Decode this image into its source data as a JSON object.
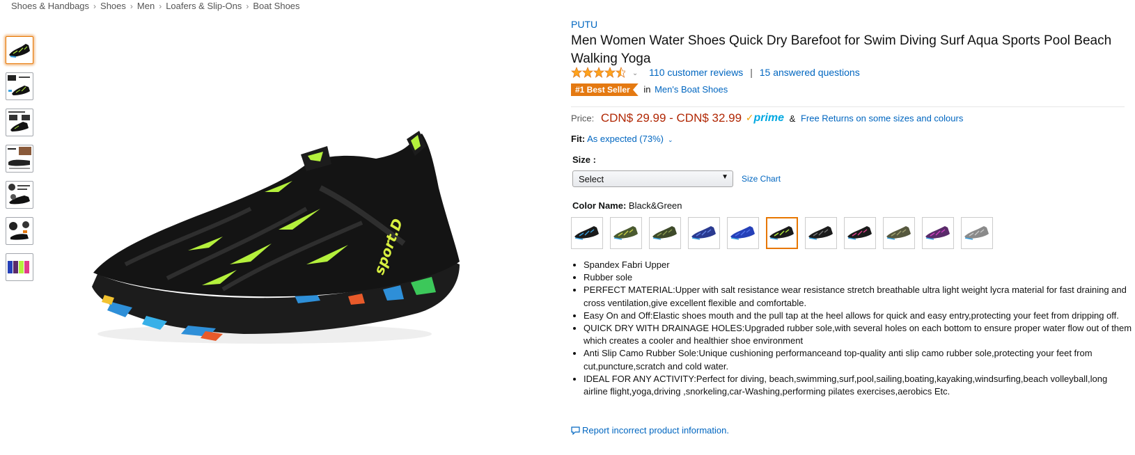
{
  "breadcrumb": [
    "Shoes & Handbags",
    "Shoes",
    "Men",
    "Loafers & Slip-Ons",
    "Boat Shoes"
  ],
  "breadcrumb_separator": "›",
  "thumbnails": [
    {
      "icon": "shoe-thumbnail",
      "selected": true
    },
    {
      "icon": "feature-thumbnail",
      "selected": false
    },
    {
      "icon": "upper-thumbnail",
      "selected": false
    },
    {
      "icon": "sole-thumbnail",
      "selected": false
    },
    {
      "icon": "resistance-thumbnail",
      "selected": false
    },
    {
      "icon": "lifestyle-thumbnail",
      "selected": false
    },
    {
      "icon": "color-variants-thumbnail",
      "selected": false
    }
  ],
  "product": {
    "brand": "PUTU",
    "title": "Men Women Water Shoes Quick Dry Barefoot for Swim Diving Surf Aqua Sports Pool Beach Walking Yoga",
    "rating_stars": 4.5,
    "rating_chevron": "⌄",
    "reviews": "110 customer reviews",
    "pipe": "|",
    "answered": "15 answered questions",
    "badge": "#1 Best Seller",
    "badge_in": "in",
    "badge_category": "Men's Boat Shoes"
  },
  "price": {
    "label": "Price:",
    "range": "CDN$ 29.99 - CDN$ 32.99",
    "prime_check": "✓",
    "prime": "prime",
    "amp": "&",
    "free_returns": "Free Returns on some sizes and colours"
  },
  "fit": {
    "label": "Fit:",
    "value": "As expected (73%)",
    "chevron": "⌄"
  },
  "size": {
    "label": "Size :",
    "selected": "Select",
    "arrow": "▼",
    "chart_link": "Size Chart"
  },
  "color": {
    "label": "Color Name:",
    "value": "Black&Green",
    "swatches": [
      {
        "name": "black-multicolor",
        "base": "#1a1a1a",
        "accent": "#37a0e0",
        "selected": false
      },
      {
        "name": "camo-green",
        "base": "#4a5a30",
        "accent": "#c8d046",
        "selected": false
      },
      {
        "name": "army-green",
        "base": "#3e4a2a",
        "accent": "#8a9a50",
        "selected": false
      },
      {
        "name": "blue-camo",
        "base": "#2a3a90",
        "accent": "#6080e0",
        "selected": false
      },
      {
        "name": "royal-blue",
        "base": "#2540b8",
        "accent": "#5070e8",
        "selected": false
      },
      {
        "name": "black-green",
        "base": "#1a1a1a",
        "accent": "#b4f03c",
        "selected": true
      },
      {
        "name": "black-grey",
        "base": "#1c1c1c",
        "accent": "#777777",
        "selected": false
      },
      {
        "name": "black-pink",
        "base": "#1a1a1a",
        "accent": "#e03c8c",
        "selected": false
      },
      {
        "name": "olive-camo",
        "base": "#56583e",
        "accent": "#a0a070",
        "selected": false
      },
      {
        "name": "purple",
        "base": "#5a2a6a",
        "accent": "#d040c0",
        "selected": false
      },
      {
        "name": "grey",
        "base": "#8a8a8a",
        "accent": "#c8c8c8",
        "selected": false
      }
    ]
  },
  "bullets": [
    "Spandex Fabri Upper",
    "Rubber sole",
    "PERFECT MATERIAL:Upper with salt resistance wear resistance stretch breathable ultra light weight lycra material for fast draining and cross ventilation,give excellent flexible and comfortable.",
    "Easy On and Off:Elastic shoes mouth and the pull tap at the heel allows for quick and easy entry,protecting your feet from dripping off.",
    "QUICK DRY WITH DRAINAGE HOLES:Upgraded rubber sole,with several holes on each bottom to ensure proper water flow out of them which creates a cooler and healthier shoe environment",
    "Anti Slip Camo Rubber Sole:Unique cushioning performanceand top-quality anti slip camo rubber sole,protecting your feet from cut,puncture,scratch and cold water.",
    "IDEAL FOR ANY ACTIVITY:Perfect for diving, beach,swimming,surf,pool,sailing,boating,kayaking,windsurfing,beach volleyball,long airline flight,yoga,driving ,snorkeling,car-Washing,performing pilates exercises,aerobics Etc."
  ],
  "report": "Report incorrect product information.",
  "colors": {
    "link": "#0066c0",
    "price": "#b12704",
    "badge": "#e47911",
    "prime": "#00a8e1",
    "selected_border": "#e77600",
    "star": "#ffa41c"
  }
}
